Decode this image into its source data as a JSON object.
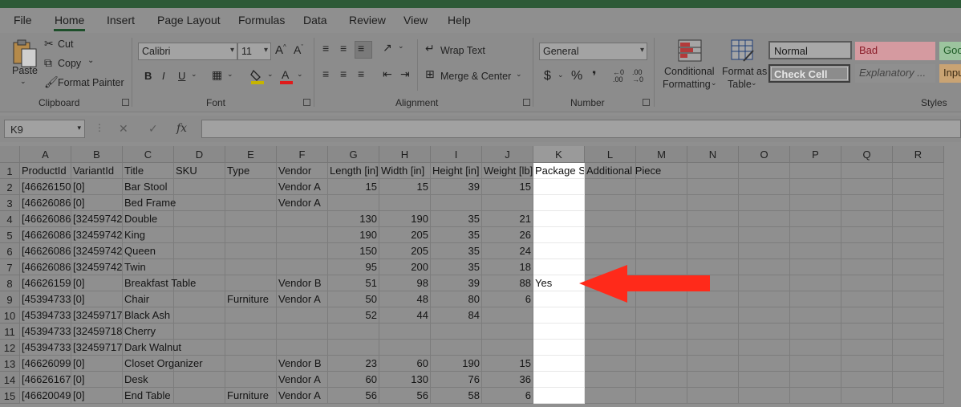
{
  "menu": {
    "tabs": [
      "File",
      "Home",
      "Insert",
      "Page Layout",
      "Formulas",
      "Data",
      "Review",
      "View",
      "Help"
    ],
    "active": "Home"
  },
  "ribbon": {
    "clipboard": {
      "paste": "Paste",
      "cut": "Cut",
      "copy": "Copy",
      "format_painter": "Format Painter",
      "label": "Clipboard"
    },
    "font": {
      "name": "Calibri",
      "size": "11",
      "bold": "B",
      "italic": "I",
      "underline": "U",
      "label": "Font",
      "font_color": "#ff0000"
    },
    "alignment": {
      "wrap_text": "Wrap Text",
      "merge_center": "Merge & Center",
      "label": "Alignment"
    },
    "number": {
      "format": "General",
      "currency": "$",
      "percent": "%",
      "comma": "❜",
      "label": "Number"
    },
    "styles": {
      "conditional_formatting": [
        "Conditional",
        "Formatting"
      ],
      "format_as_table": [
        "Format as",
        "Table"
      ],
      "label": "Styles",
      "cells": [
        {
          "name": "Normal",
          "bg": "#a8a8a8",
          "fg": "#1a1a1a"
        },
        {
          "name": "Bad",
          "bg": "#d59aa0",
          "fg": "#8b1e2a"
        },
        {
          "name": "Goo",
          "bg": "#9cc49e",
          "fg": "#1c5a24"
        },
        {
          "name": "Check Cell",
          "bg": "#8c8c8c",
          "fg": "#e6e6e6"
        },
        {
          "name": "Explanatory ...",
          "bg": "#8f8f8f",
          "fg": "#444444"
        },
        {
          "name": "Inpu",
          "bg": "#c9a373",
          "fg": "#3d2b14"
        }
      ]
    }
  },
  "formula_bar": {
    "name_box": "K9",
    "fx": "fx",
    "value": ""
  },
  "grid": {
    "columns": [
      "A",
      "B",
      "C",
      "D",
      "E",
      "F",
      "G",
      "H",
      "I",
      "J",
      "K",
      "L",
      "M",
      "N",
      "O",
      "P",
      "Q",
      "R"
    ],
    "rows": [
      {
        "n": "1",
        "cells": [
          "ProductId",
          "VariantId",
          "Title",
          "SKU",
          "Type",
          "Vendor",
          "Length [in]",
          "Width [in]",
          "Height [in]",
          "Weight [lb]",
          "Package S",
          "Additional Piece",
          "",
          "",
          "",
          "",
          "",
          ""
        ]
      },
      {
        "n": "2",
        "cells": [
          "[46626150",
          "[0]",
          "Bar Stool",
          "",
          "",
          "Vendor A",
          "15",
          "15",
          "39",
          "15",
          "",
          "",
          "",
          "",
          "",
          "",
          "",
          ""
        ]
      },
      {
        "n": "3",
        "cells": [
          "[46626086",
          "[0]",
          "Bed Frame",
          "",
          "",
          "Vendor A",
          "",
          "",
          "",
          "",
          "",
          "",
          "",
          "",
          "",
          "",
          "",
          ""
        ]
      },
      {
        "n": "4",
        "cells": [
          "[46626086",
          "[32459742",
          "Double",
          "",
          "",
          "",
          "130",
          "190",
          "35",
          "21",
          "",
          "",
          "",
          "",
          "",
          "",
          "",
          ""
        ]
      },
      {
        "n": "5",
        "cells": [
          "[46626086",
          "[32459742",
          "King",
          "",
          "",
          "",
          "190",
          "205",
          "35",
          "26",
          "",
          "",
          "",
          "",
          "",
          "",
          "",
          ""
        ]
      },
      {
        "n": "6",
        "cells": [
          "[46626086",
          "[32459742",
          "Queen",
          "",
          "",
          "",
          "150",
          "205",
          "35",
          "24",
          "",
          "",
          "",
          "",
          "",
          "",
          "",
          ""
        ]
      },
      {
        "n": "7",
        "cells": [
          "[46626086",
          "[32459742",
          "Twin",
          "",
          "",
          "",
          "95",
          "200",
          "35",
          "18",
          "",
          "",
          "",
          "",
          "",
          "",
          "",
          ""
        ]
      },
      {
        "n": "8",
        "cells": [
          "[46626159",
          "[0]",
          "Breakfast Table",
          "",
          "",
          "Vendor B",
          "51",
          "98",
          "39",
          "88",
          "Yes",
          "",
          "",
          "",
          "",
          "",
          "",
          ""
        ]
      },
      {
        "n": "9",
        "cells": [
          "[45394733",
          "[0]",
          "Chair",
          "",
          "Furniture",
          "Vendor A",
          "50",
          "48",
          "80",
          "6",
          "",
          "",
          "",
          "",
          "",
          "",
          "",
          ""
        ]
      },
      {
        "n": "10",
        "cells": [
          "[45394733",
          "[32459717",
          "Black Ash",
          "",
          "",
          "",
          "52",
          "44",
          "84",
          "",
          "",
          "",
          "",
          "",
          "",
          "",
          "",
          ""
        ]
      },
      {
        "n": "11",
        "cells": [
          "[45394733",
          "[32459718",
          "Cherry",
          "",
          "",
          "",
          "",
          "",
          "",
          "",
          "",
          "",
          "",
          "",
          "",
          "",
          "",
          ""
        ]
      },
      {
        "n": "12",
        "cells": [
          "[45394733",
          "[32459717",
          "Dark Walnut",
          "",
          "",
          "",
          "",
          "",
          "",
          "",
          "",
          "",
          "",
          "",
          "",
          "",
          "",
          ""
        ]
      },
      {
        "n": "13",
        "cells": [
          "[46626099",
          "[0]",
          "Closet Organizer",
          "",
          "",
          "Vendor B",
          "23",
          "60",
          "190",
          "15",
          "",
          "",
          "",
          "",
          "",
          "",
          "",
          ""
        ]
      },
      {
        "n": "14",
        "cells": [
          "[46626167",
          "[0]",
          "Desk",
          "",
          "",
          "Vendor A",
          "60",
          "130",
          "76",
          "36",
          "",
          "",
          "",
          "",
          "",
          "",
          "",
          ""
        ]
      },
      {
        "n": "15",
        "cells": [
          "[46620049",
          "[0]",
          "End Table",
          "",
          "Furniture",
          "Vendor A",
          "56",
          "56",
          "58",
          "6",
          "",
          "",
          "",
          "",
          "",
          "",
          "",
          ""
        ]
      }
    ]
  },
  "annotation": {
    "arrow_color": "#ff2a1a"
  }
}
